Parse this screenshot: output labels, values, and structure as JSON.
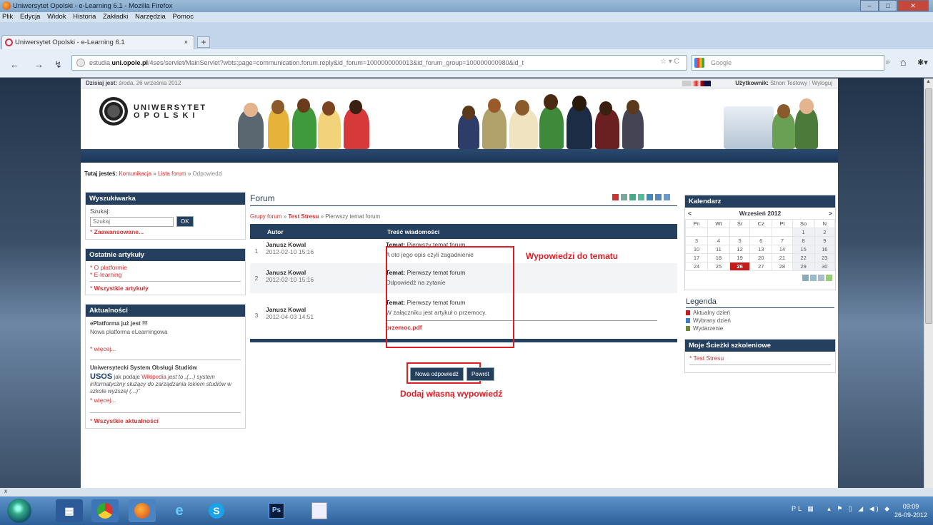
{
  "browser": {
    "window_title": "Uniwersytet Opolski - e-Learning 6.1 - Mozilla Firefox",
    "menu": [
      "Plik",
      "Edycja",
      "Widok",
      "Historia",
      "Zakładki",
      "Narzędzia",
      "Pomoc"
    ],
    "tab_title": "Uniwersytet Opolski - e-Learning 6.1",
    "url_prefix": "estudia.",
    "url_domain": "uni.opole.pl",
    "url_rest": "/4ses/servlet/MainServlet?wbts:page=communication.forum.reply&id_forum=1000000000013&id_forum_group=100000000980&id_t",
    "search_placeholder": "Google"
  },
  "site": {
    "today_label": "Dzisiaj jest:",
    "today_value": "środa, 26 września 2012",
    "user_label": "Użytkownik:",
    "user_value": "Stnon Testowy",
    "logout": "Wyloguj",
    "logo_line1": "UNIWERSYTET",
    "logo_line2": "OPOLSKI",
    "here_label": "Tutaj jesteś:",
    "breadcrumb": [
      "Komunikacja",
      "Lista forum",
      "Odpowiedzi"
    ]
  },
  "left": {
    "search_title": "Wyszukiwarka",
    "search_label": "Szukaj:",
    "search_placeholder": "Szukaj",
    "search_button": "OK",
    "advanced": "Zaawansowane...",
    "articles_title": "Ostatnie artykuły",
    "articles": [
      "O platformie",
      "E-learning"
    ],
    "all_articles": "Wszystkie artykuły",
    "news_title": "Aktualności",
    "news1_title": "ePlatforma już jest !!!",
    "news1_body": "Nowa platforma eLearningowa",
    "more": "więcej...",
    "news2_title": "Uniwersytecki System Obsługi Studiów",
    "news2_logo": "USOS",
    "news2_body1": "jak podaje",
    "news2_link": "Wikipedia",
    "news2_body2": "jest to „(...) system informatyczny służący do zarządzania tokiem studiów w szkole wyższej (...)”",
    "all_news": "Wszystkie aktualności"
  },
  "forum": {
    "title": "Forum",
    "crumb_groups": "Grupy forum",
    "crumb_test": "Test Stresu",
    "crumb_topic": "Pierwszy temat forum",
    "col_author": "Autor",
    "col_content": "Treść wiadomości",
    "topic_label": "Temat:",
    "posts": [
      {
        "num": "1",
        "author": "Janusz Kowal",
        "date": "2012-02-10 15:16",
        "topic": "Pierwszy temat forum",
        "body": "A oto jego opis czyli zagadnienie",
        "attachment": ""
      },
      {
        "num": "2",
        "author": "Janusz Kowal",
        "date": "2012-02-10 15:16",
        "topic": "Pierwszy temat forum",
        "body": "Odpowiedź na zytanie",
        "attachment": ""
      },
      {
        "num": "3",
        "author": "Janusz Kowal",
        "date": "2012-04-03 14:51",
        "topic": "Pierwszy temat forum",
        "body": "W załączniku jest artykuł o przemocy.",
        "attachment": "przemoc.pdf"
      }
    ],
    "annotation_posts": "Wypowiedzi do tematu",
    "btn_new_reply": "Nowa odpowiedź",
    "btn_back": "Powrót",
    "annotation_add": "Dodaj własną wypowiedź"
  },
  "calendar": {
    "title": "Kalendarz",
    "prev": "<",
    "next": ">",
    "month": "Wrzesień 2012",
    "weekdays": [
      "Pn",
      "Wt",
      "Śr",
      "Cz",
      "Pt",
      "So",
      "N"
    ],
    "weeks": [
      [
        "",
        "",
        "",
        "",
        "",
        "1",
        "2"
      ],
      [
        "3",
        "4",
        "5",
        "6",
        "7",
        "8",
        "9"
      ],
      [
        "10",
        "11",
        "12",
        "13",
        "14",
        "15",
        "16"
      ],
      [
        "17",
        "18",
        "19",
        "20",
        "21",
        "22",
        "23"
      ],
      [
        "24",
        "25",
        "26",
        "27",
        "28",
        "29",
        "30"
      ]
    ],
    "today": "26",
    "legend_title": "Legenda",
    "legend": [
      "Aktualny dzień",
      "Wybrany dzień",
      "Wydarzenie"
    ],
    "paths_title": "Moje Ścieżki szkoleniowe",
    "paths": [
      "Test Stresu"
    ]
  },
  "status": {
    "text": "x"
  },
  "taskbar": {
    "lang": "PL",
    "time": "09:09",
    "date": "26-09-2012"
  },
  "colors": {
    "accent": "#25405f",
    "annotation": "#e01c24",
    "link": "#cc3333"
  }
}
